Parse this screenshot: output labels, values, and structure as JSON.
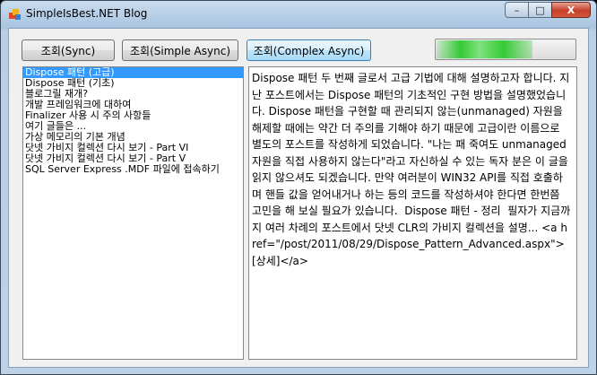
{
  "window": {
    "title": "SimpleIsBest.NET Blog",
    "controls": {
      "minimize": "–",
      "maximize": "□",
      "close": "X"
    }
  },
  "toolbar": {
    "sync_label": "조회(Sync)",
    "simple_async_label": "조회(Simple Async)",
    "complex_async_label": "조회(Complex Async)"
  },
  "progress": {
    "value_fraction": 0.7,
    "color": "#36c936"
  },
  "posts": [
    "Dispose 패턴 (고급)",
    "Dispose 패턴 (기초)",
    "블로그릴 재개?",
    "개발 프레임워크에 대하여",
    "Finalizer 사용 시 주의 사항들",
    "여기 글들은 ...",
    "가상 메모리의 기본 개념",
    "닷넷 가비지 컬렉션 다시 보기 - Part VI",
    "닷넷 가비지 컬렉션 다시 보기 - Part V",
    "SQL Server Express .MDF 파일에 접속하기"
  ],
  "selected_index": 0,
  "content": "Dispose 패턴 두 번째 글로서 고급 기법에 대해 설명하고자 합니다. 지난 포스트에서는 Dispose 패턴의 기초적인 구현 방법을 설명했었습니다. Dispose 패턴을 구현할 때 관리되지 않는(unmanaged) 자원을 해제할 때에는 약간 더 주의를 기해야 하기 때문에 고급이란 이름으로 별도의 포스트를 작성하게 되었습니다. \"나는 패 죽여도 unmanaged 자원을 직접 사용하지 않는다\"라고 자신하실 수 있는 독자 분은 이 글을 읽지 않으셔도 되겠습니다. 만약 여러분이 WIN32 API를 직접 호출하며 핸들 값을 얻어내거나 하는 등의 코드를 작성하셔야 한다면 한번쯤 고민을 해 보실 필요가 있습니다.  Dispose 패턴 - 정리  필자가 지금까지 여러 차례의 포스트에서 닷넷 CLR의 가비지 컬렉션을 설명... <a href=\"/post/2011/08/29/Dispose_Pattern_Advanced.aspx\">[상세]</a>",
  "colors": {
    "selection": "#3399ff",
    "titlebar": "#b8cfe6",
    "close_button": "#c7402a"
  }
}
